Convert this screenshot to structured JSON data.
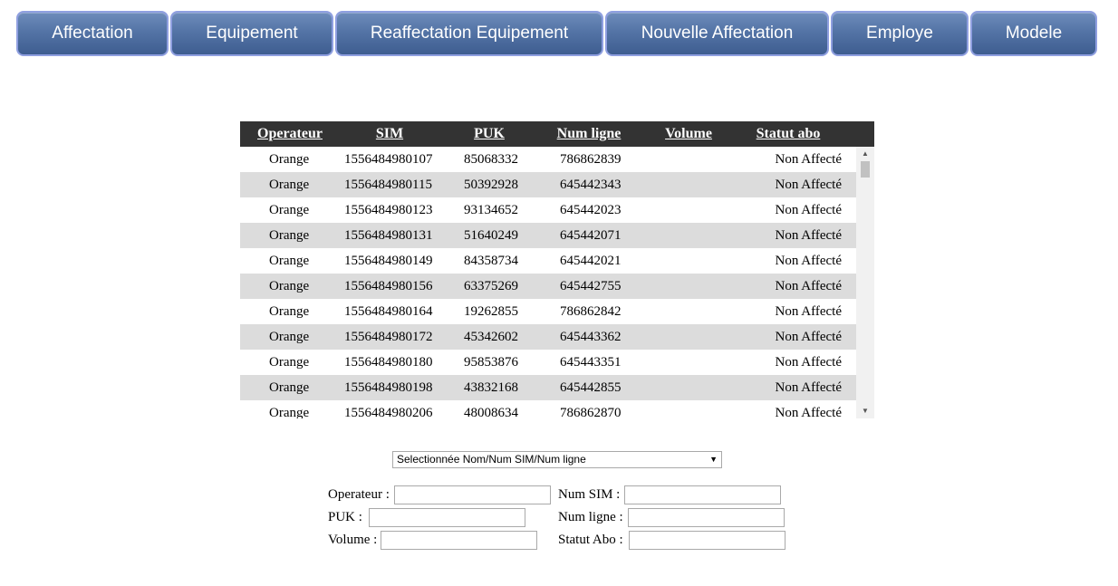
{
  "nav": {
    "items": [
      {
        "label": "Affectation"
      },
      {
        "label": "Equipement"
      },
      {
        "label": "Reaffectation Equipement"
      },
      {
        "label": "Nouvelle Affectation"
      },
      {
        "label": "Employe"
      },
      {
        "label": "Modele"
      }
    ]
  },
  "table": {
    "headers": {
      "operateur": "Operateur",
      "sim": "SIM",
      "puk": "PUK",
      "num_ligne": "Num ligne",
      "volume": "Volume",
      "statut": "Statut abo"
    },
    "rows": [
      {
        "operateur": "Orange",
        "sim": "1556484980107",
        "puk": "85068332",
        "num_ligne": "786862839",
        "volume": "",
        "statut": "Non Affecté"
      },
      {
        "operateur": "Orange",
        "sim": "1556484980115",
        "puk": "50392928",
        "num_ligne": "645442343",
        "volume": "",
        "statut": "Non Affecté"
      },
      {
        "operateur": "Orange",
        "sim": "1556484980123",
        "puk": "93134652",
        "num_ligne": "645442023",
        "volume": "",
        "statut": "Non Affecté"
      },
      {
        "operateur": "Orange",
        "sim": "1556484980131",
        "puk": "51640249",
        "num_ligne": "645442071",
        "volume": "",
        "statut": "Non Affecté"
      },
      {
        "operateur": "Orange",
        "sim": "1556484980149",
        "puk": "84358734",
        "num_ligne": "645442021",
        "volume": "",
        "statut": "Non Affecté"
      },
      {
        "operateur": "Orange",
        "sim": "1556484980156",
        "puk": "63375269",
        "num_ligne": "645442755",
        "volume": "",
        "statut": "Non Affecté"
      },
      {
        "operateur": "Orange",
        "sim": "1556484980164",
        "puk": "19262855",
        "num_ligne": "786862842",
        "volume": "",
        "statut": "Non Affecté"
      },
      {
        "operateur": "Orange",
        "sim": "1556484980172",
        "puk": "45342602",
        "num_ligne": "645443362",
        "volume": "",
        "statut": "Non Affecté"
      },
      {
        "operateur": "Orange",
        "sim": "1556484980180",
        "puk": "95853876",
        "num_ligne": "645443351",
        "volume": "",
        "statut": "Non Affecté"
      },
      {
        "operateur": "Orange",
        "sim": "1556484980198",
        "puk": "43832168",
        "num_ligne": "645442855",
        "volume": "",
        "statut": "Non Affecté"
      },
      {
        "operateur": "Orange",
        "sim": "1556484980206",
        "puk": "48008634",
        "num_ligne": "786862870",
        "volume": "",
        "statut": "Non Affecté"
      }
    ]
  },
  "filter": {
    "selected": "Selectionnée Nom/Num SIM/Num ligne"
  },
  "form": {
    "operateur_label": "Operateur :",
    "operateur_value": "",
    "num_sim_label": "Num SIM :",
    "num_sim_value": "",
    "puk_label": "PUK :",
    "puk_value": "",
    "num_ligne_label": "Num ligne :",
    "num_ligne_value": "",
    "volume_label": "Volume :",
    "volume_value": "",
    "statut_abo_label": "Statut Abo :",
    "statut_abo_value": ""
  },
  "colors": {
    "nav_button": "#5474a6",
    "nav_border": "#8f9fe0",
    "table_header": "#333333",
    "row_alt": "#dcdcdc"
  },
  "icons": {
    "select_arrow": "triangle-down-icon",
    "scroll_up": "triangle-up-icon",
    "scroll_down": "triangle-down-icon"
  }
}
